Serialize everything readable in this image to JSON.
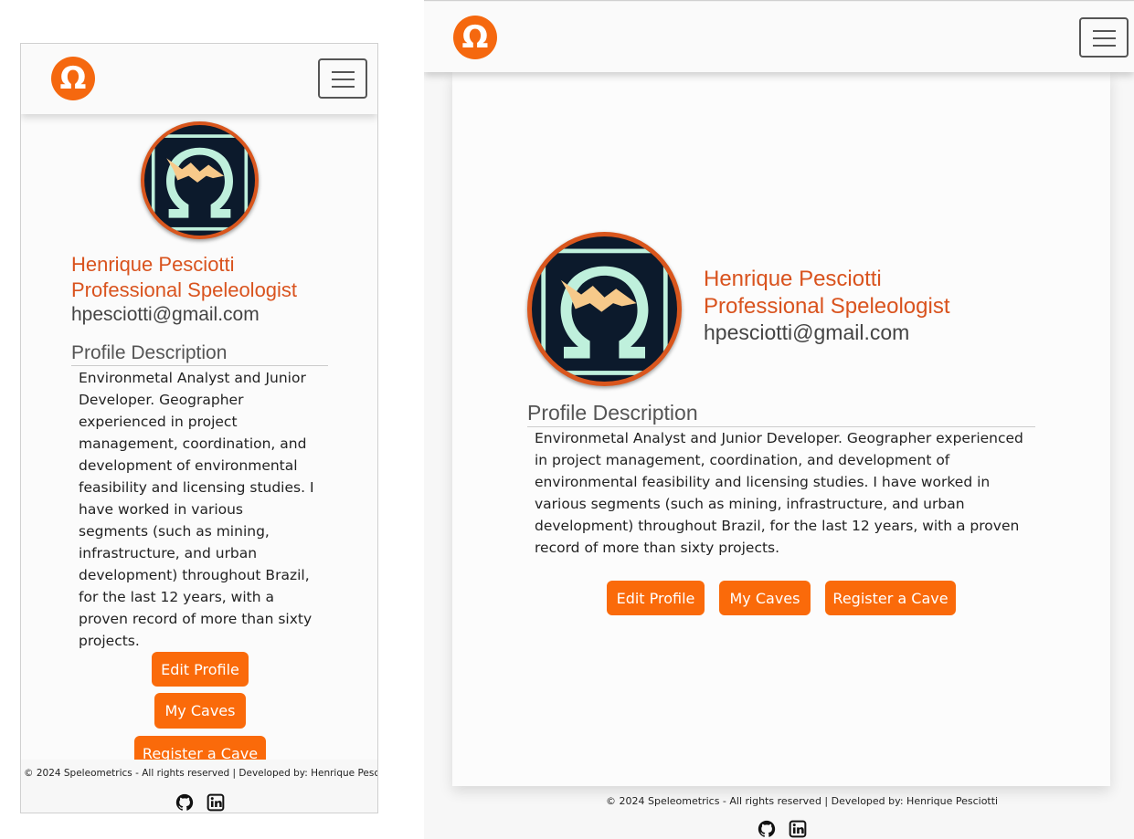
{
  "brand": {
    "logo_glyph": "Ω",
    "accent_color": "#fa6a0a",
    "name_color": "#d9531e"
  },
  "nav": {
    "menu_icon": "hamburger-menu-icon"
  },
  "profile": {
    "name": "Henrique Pesciotti",
    "title": "Professional Speleologist",
    "email": "hpesciotti@gmail.com",
    "avatar_icon": "omega-bat-avatar"
  },
  "description": {
    "heading": "Profile Description",
    "text": "Environmetal Analyst and Junior Developer. Geographer experienced in project management, coordination, and development of environmental feasibility and licensing studies. I have worked in various segments (such as mining, infrastructure, and urban development) throughout Brazil, for the last 12 years, with a proven record of more than sixty projects."
  },
  "actions": {
    "edit_profile": "Edit Profile",
    "my_caves": "My Caves",
    "register_cave": "Register a Cave"
  },
  "footer": {
    "copyright": "© 2024 Speleometrics - All rights reserved | Developed by: Henrique Pesciotti",
    "icons": [
      "github-icon",
      "linkedin-icon"
    ]
  }
}
